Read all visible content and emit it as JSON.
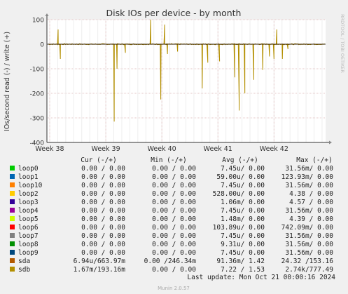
{
  "chart_data": {
    "type": "line",
    "title": "Disk IOs per device - by month",
    "ylabel": "IOs/second read (-) / write (+)",
    "side_label": "RRDTOOL / TOBI OETIKER",
    "footer": "Munin 2.0.57",
    "last_update": "Last update: Mon Oct 21 00:00:16 2024",
    "x_ticks": [
      "Week 38",
      "Week 39",
      "Week 40",
      "Week 41",
      "Week 42"
    ],
    "y_ticks": [
      100,
      0,
      -100,
      -200,
      -300,
      -400
    ],
    "ylim": [
      -400,
      100
    ],
    "grid": true,
    "legend_header": [
      "Cur (-/+)",
      "Min (-/+)",
      "Avg (-/+)",
      "Max (-/+)"
    ],
    "series": [
      {
        "name": "loop0",
        "color": "#00cc00",
        "cur": "0.00 /  0.00",
        "min": "0.00 /  0.00",
        "avg": "7.45u/  0.00",
        "max": "31.56m/  0.00"
      },
      {
        "name": "loop1",
        "color": "#0066b3",
        "cur": "0.00 /  0.00",
        "min": "0.00 /  0.00",
        "avg": "59.00u/  0.00",
        "max": "123.93m/  0.00"
      },
      {
        "name": "loop10",
        "color": "#ff8000",
        "cur": "0.00 /  0.00",
        "min": "0.00 /  0.00",
        "avg": "7.45u/  0.00",
        "max": "31.56m/  0.00"
      },
      {
        "name": "loop2",
        "color": "#ffcc00",
        "cur": "0.00 /  0.00",
        "min": "0.00 /  0.00",
        "avg": "528.00u/  0.00",
        "max": "4.38 /  0.00"
      },
      {
        "name": "loop3",
        "color": "#330099",
        "cur": "0.00 /  0.00",
        "min": "0.00 /  0.00",
        "avg": "1.06m/  0.00",
        "max": "4.57 /  0.00"
      },
      {
        "name": "loop4",
        "color": "#990099",
        "cur": "0.00 /  0.00",
        "min": "0.00 /  0.00",
        "avg": "7.45u/  0.00",
        "max": "31.56m/  0.00"
      },
      {
        "name": "loop5",
        "color": "#ccff00",
        "cur": "0.00 /  0.00",
        "min": "0.00 /  0.00",
        "avg": "1.48m/  0.00",
        "max": "4.39 /  0.00"
      },
      {
        "name": "loop6",
        "color": "#ff0000",
        "cur": "0.00 /  0.00",
        "min": "0.00 /  0.00",
        "avg": "103.89u/  0.00",
        "max": "742.09m/  0.00"
      },
      {
        "name": "loop7",
        "color": "#808080",
        "cur": "0.00 /  0.00",
        "min": "0.00 /  0.00",
        "avg": "7.45u/  0.00",
        "max": "31.56m/  0.00"
      },
      {
        "name": "loop8",
        "color": "#008f00",
        "cur": "0.00 /  0.00",
        "min": "0.00 /  0.00",
        "avg": "9.31u/  0.00",
        "max": "31.56m/  0.00"
      },
      {
        "name": "loop9",
        "color": "#00487d",
        "cur": "0.00 /  0.00",
        "min": "0.00 /  0.00",
        "avg": "7.45u/  0.00",
        "max": "31.56m/  0.00"
      },
      {
        "name": "sda",
        "color": "#b35a00",
        "cur": "6.94u/663.97m",
        "min": "0.00 /246.34m",
        "avg": "91.36m/  1.42",
        "max": "24.32 /153.16"
      },
      {
        "name": "sdb",
        "color": "#b38f00",
        "cur": "1.67m/193.16m",
        "min": "0.00 /  0.00",
        "avg": "7.22 /  1.53",
        "max": "2.74k/777.49"
      }
    ],
    "sdb_peaks": [
      {
        "week": 38.15,
        "value": 60
      },
      {
        "week": 38.19,
        "value": -60
      },
      {
        "week": 39.15,
        "value": -315
      },
      {
        "week": 39.2,
        "value": -100
      },
      {
        "week": 39.35,
        "value": -35
      },
      {
        "week": 39.8,
        "value": 100
      },
      {
        "week": 39.98,
        "value": -225
      },
      {
        "week": 40.05,
        "value": 80
      },
      {
        "week": 40.1,
        "value": -40
      },
      {
        "week": 40.28,
        "value": -30
      },
      {
        "week": 40.72,
        "value": -180
      },
      {
        "week": 40.82,
        "value": -75
      },
      {
        "week": 41.03,
        "value": -70
      },
      {
        "week": 41.3,
        "value": -135
      },
      {
        "week": 41.38,
        "value": -270
      },
      {
        "week": 41.48,
        "value": -200
      },
      {
        "week": 41.64,
        "value": -145
      },
      {
        "week": 41.8,
        "value": -105
      },
      {
        "week": 41.92,
        "value": -50
      },
      {
        "week": 42.0,
        "value": -60
      },
      {
        "week": 42.05,
        "value": 60
      },
      {
        "week": 42.15,
        "value": -60
      },
      {
        "week": 42.25,
        "value": -20
      }
    ]
  }
}
